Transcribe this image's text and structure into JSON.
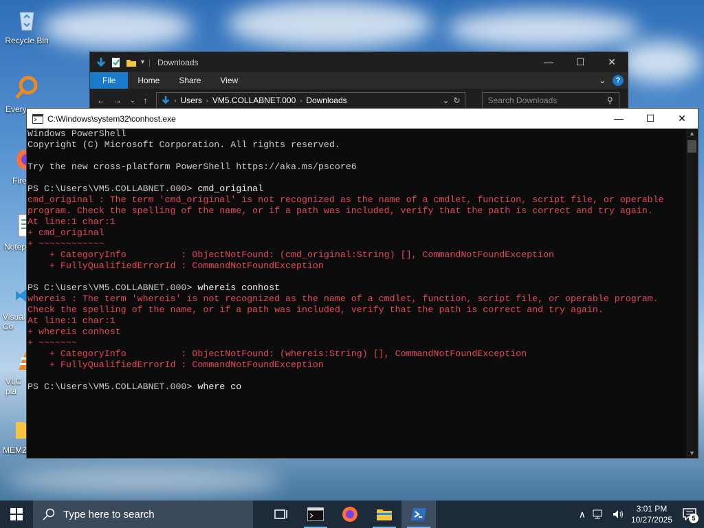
{
  "desktop": {
    "icons": [
      {
        "label": "Recycle Bin"
      },
      {
        "label": "Every"
      },
      {
        "label": "Fire"
      },
      {
        "label": "Notep"
      },
      {
        "label": "Visual Co"
      },
      {
        "label": "VLC pla"
      },
      {
        "label": "MEMZ"
      }
    ]
  },
  "explorer": {
    "title": "Downloads",
    "ribbon": {
      "file": "File",
      "home": "Home",
      "share": "Share",
      "view": "View"
    },
    "address": [
      "Users",
      "VM5.COLLABNET.000",
      "Downloads"
    ],
    "search_placeholder": "Search Downloads"
  },
  "console": {
    "title": "C:\\Windows\\system32\\conhost.exe",
    "lines": [
      {
        "cls": "",
        "text": "Windows PowerShell"
      },
      {
        "cls": "",
        "text": "Copyright (C) Microsoft Corporation. All rights reserved."
      },
      {
        "cls": "",
        "text": ""
      },
      {
        "cls": "",
        "text": "Try the new cross-platform PowerShell https://aka.ms/pscore6"
      },
      {
        "cls": "",
        "text": ""
      },
      {
        "cls": "prompt",
        "text": "PS C:\\Users\\VM5.COLLABNET.000> ",
        "cmd": "cmd_original"
      },
      {
        "cls": "err",
        "text": "cmd_original : The term 'cmd_original' is not recognized as the name of a cmdlet, function, script file, or operable"
      },
      {
        "cls": "err",
        "text": "program. Check the spelling of the name, or if a path was included, verify that the path is correct and try again."
      },
      {
        "cls": "err",
        "text": "At line:1 char:1"
      },
      {
        "cls": "err",
        "text": "+ cmd_original"
      },
      {
        "cls": "err",
        "text": "+ ~~~~~~~~~~~~"
      },
      {
        "cls": "err",
        "text": "    + CategoryInfo          : ObjectNotFound: (cmd_original:String) [], CommandNotFoundException"
      },
      {
        "cls": "err",
        "text": "    + FullyQualifiedErrorId : CommandNotFoundException"
      },
      {
        "cls": "",
        "text": ""
      },
      {
        "cls": "prompt",
        "text": "PS C:\\Users\\VM5.COLLABNET.000> ",
        "cmd": "whereis conhost"
      },
      {
        "cls": "err",
        "text": "whereis : The term 'whereis' is not recognized as the name of a cmdlet, function, script file, or operable program."
      },
      {
        "cls": "err",
        "text": "Check the spelling of the name, or if a path was included, verify that the path is correct and try again."
      },
      {
        "cls": "err",
        "text": "At line:1 char:1"
      },
      {
        "cls": "err",
        "text": "+ whereis conhost"
      },
      {
        "cls": "err",
        "text": "+ ~~~~~~~"
      },
      {
        "cls": "err",
        "text": "    + CategoryInfo          : ObjectNotFound: (whereis:String) [], CommandNotFoundException"
      },
      {
        "cls": "err",
        "text": "    + FullyQualifiedErrorId : CommandNotFoundException"
      },
      {
        "cls": "",
        "text": ""
      },
      {
        "cls": "prompt",
        "text": "PS C:\\Users\\VM5.COLLABNET.000> ",
        "cmd": "where co"
      }
    ]
  },
  "taskbar": {
    "search_placeholder": "Type here to search",
    "time": "3:01 PM",
    "date": "10/27/2025",
    "notification_count": "5"
  },
  "colors": {
    "error": "#e74856",
    "accent": "#1979ca",
    "console_bg": "#0c0c0c"
  }
}
